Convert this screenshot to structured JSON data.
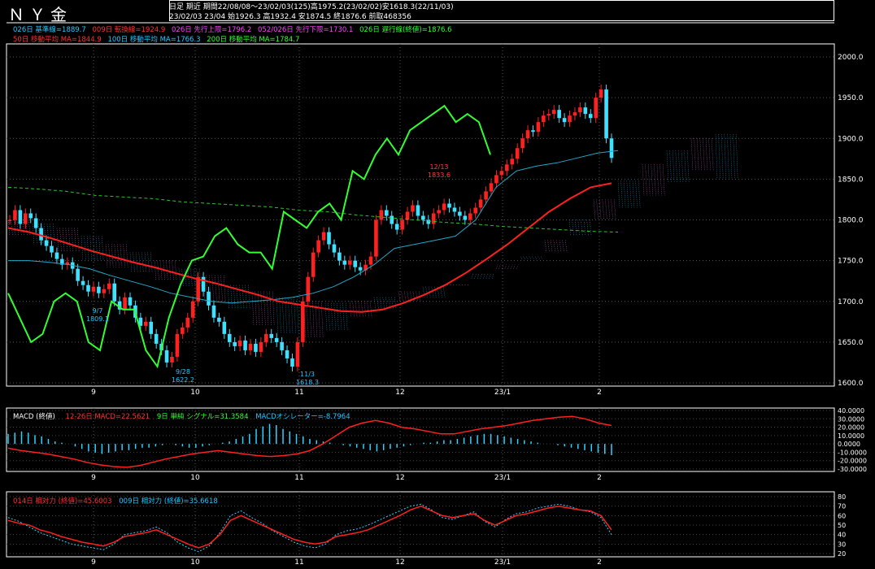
{
  "header": {
    "title": "ＮＹ金",
    "line1": "日足 期近 期間22/08/08～23/02/03(125)高1975.2(23/02/02)安1618.3(22/11/03)",
    "line2": "23/02/03 23/04 始1926.3 高1932.4 安1874.5 終1876.6 前取468356"
  },
  "indicators": {
    "row1": [
      {
        "text": "026日 基準線=1889.7",
        "color": "#22c8ff"
      },
      {
        "text": "009日 転換線=1924.9",
        "color": "#ff3030"
      },
      {
        "text": "026日 先行上限=1796.2",
        "color": "#ff40ff"
      },
      {
        "text": "052/026日 先行下限=1730.1",
        "color": "#ff40ff"
      },
      {
        "text": "026日 遅行線(終値)=1876.6",
        "color": "#30ff30"
      }
    ],
    "row2": [
      {
        "text": "50日 移動平均 MA=1844.9",
        "color": "#ff3030"
      },
      {
        "text": "100日 移動平均 MA=1766.3",
        "color": "#22c8ff"
      },
      {
        "text": "200日 移動平均 MA=1784.7",
        "color": "#30ff30"
      }
    ]
  },
  "macd_panel": {
    "name": "MACD (終値)",
    "legend": [
      {
        "text": "12-26日 MACD=22.5621",
        "color": "#ff3030"
      },
      {
        "text": "9日 単純 シグナル=31.3584",
        "color": "#30ff30"
      },
      {
        "text": "MACDオシレーター=-8.7964",
        "color": "#22c8ff"
      }
    ]
  },
  "rsi_panel": {
    "legend": [
      {
        "text": "014日 相対力 (終値)=45.6003",
        "color": "#ff3030"
      },
      {
        "text": "009日 相対力 (終値)=35.6618",
        "color": "#22c8ff"
      }
    ]
  },
  "annotations": [
    {
      "text": "9/7",
      "value": "1809.1"
    },
    {
      "text": "9/28",
      "value": "1622.2"
    },
    {
      "text": "11/3",
      "value": "1618.3"
    },
    {
      "text": "12/13",
      "value": "1833.6"
    }
  ],
  "chart_data": [
    {
      "type": "candlestick",
      "x_ticks": [
        "9",
        "10",
        "11",
        "12",
        "23/1",
        "2"
      ],
      "y_ticks": [
        "2000.0",
        "1950.0",
        "1900.0",
        "1850.0",
        "1800.0",
        "1750.0",
        "1700.0",
        "1650.0",
        "1600.0"
      ],
      "ylim": [
        1600,
        2000
      ],
      "ohlc_close": [
        1800,
        1812,
        1795,
        1808,
        1802,
        1790,
        1775,
        1768,
        1760,
        1752,
        1745,
        1748,
        1740,
        1725,
        1720,
        1712,
        1718,
        1710,
        1715,
        1722,
        1700,
        1690,
        1705,
        1695,
        1680,
        1670,
        1675,
        1660,
        1648,
        1640,
        1625,
        1632,
        1660,
        1668,
        1680,
        1700,
        1730,
        1712,
        1695,
        1680,
        1675,
        1660,
        1650,
        1645,
        1652,
        1640,
        1648,
        1638,
        1650,
        1660,
        1655,
        1650,
        1640,
        1630,
        1620,
        1650,
        1700,
        1730,
        1760,
        1775,
        1785,
        1770,
        1760,
        1750,
        1745,
        1750,
        1742,
        1738,
        1745,
        1755,
        1800,
        1812,
        1805,
        1795,
        1788,
        1800,
        1810,
        1818,
        1805,
        1800,
        1795,
        1808,
        1812,
        1820,
        1815,
        1810,
        1805,
        1800,
        1808,
        1815,
        1825,
        1835,
        1845,
        1855,
        1860,
        1868,
        1875,
        1888,
        1900,
        1910,
        1908,
        1920,
        1928,
        1930,
        1935,
        1925,
        1920,
        1928,
        1932,
        1938,
        1930,
        1925,
        1950,
        1960,
        1900,
        1876
      ],
      "series": [
        {
          "name": "MA50",
          "values": [
            1790,
            1785,
            1778,
            1770,
            1762,
            1755,
            1748,
            1742,
            1735,
            1728,
            1722,
            1715,
            1708,
            1700,
            1696,
            1692,
            1688,
            1687,
            1690,
            1698,
            1708,
            1720,
            1735,
            1752,
            1770,
            1790,
            1810,
            1826,
            1840,
            1845
          ]
        },
        {
          "name": "MA100",
          "values": [
            1750,
            1750,
            1748,
            1745,
            1740,
            1732,
            1725,
            1718,
            1710,
            1705,
            1700,
            1698,
            1700,
            1702,
            1705,
            1710,
            1718,
            1730,
            1745,
            1765,
            1770,
            1775,
            1780,
            1800,
            1840,
            1860,
            1866,
            1870,
            1876,
            1882,
            1885
          ]
        },
        {
          "name": "MA200",
          "values": [
            1840,
            1838,
            1835,
            1830,
            1828,
            1826,
            1822,
            1820,
            1818,
            1816,
            1812,
            1810,
            1806,
            1803,
            1800,
            1797,
            1795,
            1792,
            1790,
            1788,
            1786,
            1785
          ]
        },
        {
          "name": "Chikou",
          "values": [
            1710,
            1680,
            1650,
            1660,
            1700,
            1710,
            1700,
            1650,
            1640,
            1700,
            1690,
            1690,
            1640,
            1620,
            1680,
            1720,
            1750,
            1755,
            1780,
            1790,
            1770,
            1760,
            1760,
            1740,
            1810,
            1800,
            1790,
            1810,
            1820,
            1800,
            1860,
            1850,
            1880,
            1900,
            1880,
            1910,
            1920,
            1930,
            1940,
            1920,
            1930,
            1920,
            1880
          ]
        }
      ]
    },
    {
      "type": "bar",
      "title": "MACD",
      "y_ticks": [
        "40.0000",
        "30.0000",
        "20.0000",
        "10.0000",
        "0.0000",
        "-10.0000",
        "-20.0000",
        "-30.0000"
      ],
      "ylim": [
        -30,
        40
      ],
      "series": [
        {
          "name": "MACD",
          "values": [
            -5,
            -8,
            -10,
            -12,
            -15,
            -18,
            -22,
            -25,
            -27,
            -28,
            -26,
            -22,
            -18,
            -15,
            -12,
            -10,
            -8,
            -10,
            -12,
            -14,
            -15,
            -14,
            -12,
            -8,
            0,
            10,
            20,
            25,
            28,
            25,
            20,
            18,
            15,
            12,
            12,
            15,
            18,
            20,
            22,
            25,
            28,
            30,
            32,
            33,
            30,
            25,
            22
          ]
        },
        {
          "name": "Oscillator",
          "values": [
            8,
            9,
            10,
            9,
            7,
            6,
            4,
            2,
            1,
            0,
            -2,
            -4,
            -6,
            -7,
            -8,
            -7,
            -6,
            -5,
            -5,
            -4,
            -3,
            -3,
            -2,
            -1,
            0,
            -1,
            -2,
            -3,
            -3,
            -2,
            -1,
            0,
            1,
            2,
            4,
            6,
            8,
            12,
            14,
            16,
            15,
            12,
            10,
            8,
            6,
            4,
            3,
            2,
            1,
            0,
            -1,
            -2,
            -3,
            -4,
            -5,
            -6,
            -5,
            -4,
            -3,
            -2,
            -1,
            0,
            1,
            1,
            2,
            3,
            3,
            4,
            5,
            6,
            7,
            8,
            8,
            7,
            6,
            5,
            4,
            3,
            2,
            1,
            0,
            0,
            -1,
            -2,
            -3,
            -4,
            -5,
            -6,
            -7,
            -8,
            -9
          ]
        }
      ]
    },
    {
      "type": "line",
      "title": "RSI",
      "y_ticks": [
        "80",
        "70",
        "60",
        "50",
        "40",
        "30",
        "20"
      ],
      "ylim": [
        20,
        80
      ],
      "series": [
        {
          "name": "RSI14",
          "values": [
            55,
            52,
            50,
            45,
            42,
            38,
            35,
            32,
            30,
            28,
            32,
            38,
            40,
            42,
            45,
            40,
            35,
            30,
            26,
            30,
            40,
            55,
            60,
            55,
            50,
            45,
            40,
            35,
            32,
            30,
            32,
            38,
            40,
            42,
            45,
            50,
            55,
            60,
            66,
            70,
            65,
            60,
            58,
            60,
            62,
            55,
            50,
            55,
            60,
            62,
            65,
            68,
            70,
            68,
            66,
            65,
            60,
            45
          ]
        },
        {
          "name": "RSI9",
          "values": [
            58,
            54,
            48,
            42,
            38,
            34,
            30,
            28,
            26,
            24,
            30,
            40,
            42,
            44,
            48,
            42,
            32,
            26,
            22,
            28,
            42,
            60,
            65,
            58,
            52,
            44,
            38,
            32,
            28,
            26,
            30,
            40,
            44,
            46,
            50,
            55,
            60,
            65,
            70,
            72,
            66,
            58,
            56,
            60,
            64,
            54,
            48,
            56,
            62,
            64,
            68,
            70,
            72,
            70,
            66,
            64,
            58,
            40
          ]
        }
      ]
    }
  ]
}
